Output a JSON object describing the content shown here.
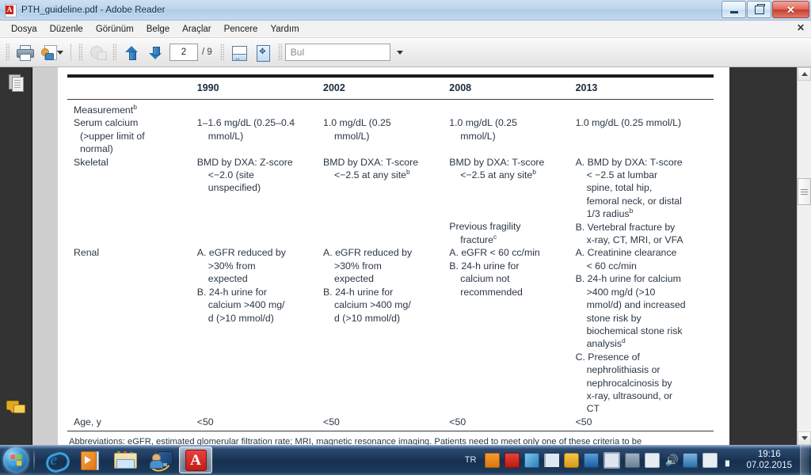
{
  "window": {
    "title": "PTH_guideline.pdf - Adobe Reader",
    "icon": "pdf-file-icon",
    "minimize_label": "–",
    "maximize_label": "❐",
    "close_label": "✕"
  },
  "menubar": {
    "items": [
      {
        "label": "Dosya"
      },
      {
        "label": "Düzenle"
      },
      {
        "label": "Görünüm"
      },
      {
        "label": "Belge"
      },
      {
        "label": "Araçlar"
      },
      {
        "label": "Pencere"
      },
      {
        "label": "Yardım"
      }
    ],
    "close_document_label": "✕"
  },
  "toolbar": {
    "print_label": "print-icon",
    "share_label": "share-icon",
    "share_dropdown_label": "▾",
    "globe_label": "globe-icon",
    "prev_page_label": "previous-page-icon",
    "next_page_label": "next-page-icon",
    "page_number": "2",
    "page_total": "/ 9",
    "fit_width_label": "fit-width-icon",
    "fit_page_label": "fit-page-icon",
    "find_placeholder": "Bul",
    "find_value": "",
    "find_dropdown_label": "▾"
  },
  "navpane": {
    "items": [
      {
        "name": "page-thumbnails",
        "icon": "pages-icon"
      },
      {
        "name": "comments",
        "icon": "comment-icon"
      },
      {
        "name": "attachments",
        "icon": "paperclip-icon"
      }
    ]
  },
  "scrollbar": {
    "up_label": "▲",
    "down_label": "▼"
  },
  "document": {
    "table": {
      "columns": [
        "",
        "1990",
        "2002",
        "2008",
        "2013"
      ],
      "rows": [
        {
          "label": "Measurement",
          "label_sup": "b",
          "cells": [
            "",
            "",
            "",
            ""
          ]
        },
        {
          "label": "Serum calcium",
          "label_lines": [
            "Serum calcium",
            "(>upper limit of",
            "normal)"
          ],
          "cells": [
            "1–1.6 mg/dL (0.25–0.4 mmol/L)",
            "1.0 mg/dL (0.25 mmol/L)",
            "1.0 mg/dL (0.25 mmol/L)",
            "1.0 mg/dL (0.25 mmol/L)"
          ]
        },
        {
          "label": "Skeletal",
          "cells": [
            "BMD by DXA: Z-score <−2.0 (site unspecified)",
            "BMD by DXA: T-score <−2.5 at any site",
            "BMD by DXA: T-score <−2.5 at any site",
            "A. BMD by DXA: T-score < −2.5 at lumbar spine, total hip, femoral neck, or distal 1/3 radius"
          ],
          "cell_sups": [
            "",
            "b",
            "b",
            "b"
          ],
          "extra_cells": [
            "",
            "",
            "Previous fragility fracture",
            "B. Vertebral fracture by x-ray, CT, MRI, or VFA"
          ],
          "extra_cell_sups": [
            "",
            "",
            "c",
            ""
          ]
        },
        {
          "label": "Renal",
          "cells": [
            "A. eGFR reduced by >30% from expected\nB. 24-h urine for calcium >400 mg/d (>10 mmol/d)",
            "A. eGFR reduced by >30% from expected\nB. 24-h urine for calcium >400 mg/d (>10 mmol/d)",
            "A. eGFR < 60 cc/min\nB. 24-h urine for calcium not recommended",
            "A. Creatinine clearance < 60 cc/min\nB. 24-h urine for calcium >400 mg/d (>10 mmol/d) and increased stone risk by biochemical stone risk analysis\nC. Presence of nephrolithiasis or nephrocalcinosis by x-ray, ultrasound, or CT"
          ]
        },
        {
          "label": "Age, y",
          "cells": [
            "<50",
            "<50",
            "<50",
            "<50"
          ]
        }
      ],
      "renal_1990": {
        "a_main": "A. eGFR reduced by",
        "a_l2": ">30% from",
        "a_l3": "expected",
        "b_main": "B. 24-h urine for",
        "b_l2": "calcium >400 mg/",
        "b_l3": "d (>10 mmol/d)"
      },
      "renal_2002": {
        "a_main": "A. eGFR reduced by",
        "a_l2": ">30% from",
        "a_l3": "expected",
        "b_main": "B. 24-h urine for",
        "b_l2": "calcium >400 mg/",
        "b_l3": "d (>10 mmol/d)"
      },
      "renal_2008": {
        "a_main": "A. eGFR < 60 cc/min",
        "b_main": "B. 24-h urine for",
        "b_l2": "calcium not",
        "b_l3": "recommended"
      },
      "renal_2013": {
        "a_main": "A. Creatinine clearance",
        "a_l2": "< 60 cc/min",
        "b_main": "B. 24-h urine for calcium",
        "b_l2": ">400 mg/d (>10",
        "b_l3": "mmol/d) and increased",
        "b_l4": "stone risk by",
        "b_l5": "biochemical stone risk",
        "b_l6": "analysis",
        "b_sup": "d",
        "c_main": "C. Presence of",
        "c_l2": "nephrolithiasis or",
        "c_l3": "nephrocalcinosis by",
        "c_l4": "x-ray, ultrasound, or",
        "c_l5": "CT"
      },
      "skeletal_1990": {
        "l1": "BMD by DXA: Z-score",
        "l2": "<−2.0 (site",
        "l3": "unspecified)"
      },
      "skeletal_2002": {
        "l1": "BMD by DXA: T-score",
        "l2": "<−2.5 at any site",
        "sup": "b"
      },
      "skeletal_2008": {
        "l1": "BMD by DXA: T-score",
        "l2": "<−2.5 at any site",
        "sup": "b",
        "l3": "Previous fragility",
        "l4": "fracture",
        "sup2": "c"
      },
      "skeletal_2013": {
        "l1": "A. BMD by DXA: T-score",
        "l2": "< −2.5 at lumbar",
        "l3": "spine, total hip,",
        "l4": "femoral neck, or distal",
        "l5": "1/3 radius",
        "sup": "b",
        "l6": "B. Vertebral fracture by",
        "l7": "x-ray, CT, MRI, or VFA"
      },
      "serum_1990_l1": "1–1.6 mg/dL (0.25–0.4",
      "serum_1990_l2": "mmol/L)",
      "serum_2002_l1": "1.0 mg/dL (0.25",
      "serum_2002_l2": "mmol/L)",
      "serum_2008_l1": "1.0 mg/dL (0.25",
      "serum_2008_l2": "mmol/L)",
      "serum_2013_l1": "1.0 mg/dL (0.25 mmol/L)"
    },
    "footnote_line1": "Abbreviations: eGFR, estimated glomerular filtration rate; MRI, magnetic resonance imaging. Patients need to meet only one of these criteria to be"
  },
  "taskbar": {
    "start_label": "start-orb",
    "items": [
      {
        "name": "internet-explorer",
        "icon": "ie-icon"
      },
      {
        "name": "windows-media-player",
        "icon": "media-player-icon"
      },
      {
        "name": "windows-explorer",
        "icon": "folder-icon"
      },
      {
        "name": "remote-desktop",
        "icon": "remote-desktop-icon"
      },
      {
        "name": "adobe-reader",
        "icon": "acrobat-icon",
        "active": true
      }
    ],
    "tray": {
      "language": "TR",
      "icons": [
        "java-icon",
        "acrobat-tray-icon",
        "paint-icon",
        "flag-icon",
        "security-icon",
        "bluetooth-icon",
        "display-icon",
        "action-center-icon",
        "update-icon",
        "volume-icon",
        "user-icon",
        "safely-remove-icon",
        "network-icon"
      ],
      "time": "19:16",
      "date": "07.02.2015"
    }
  },
  "colors": {
    "accent": "#2f78b6",
    "titlebar": "#bcd4ec",
    "taskbar": "#16304f",
    "doc_background": "#333333",
    "text": "#2b3744"
  }
}
